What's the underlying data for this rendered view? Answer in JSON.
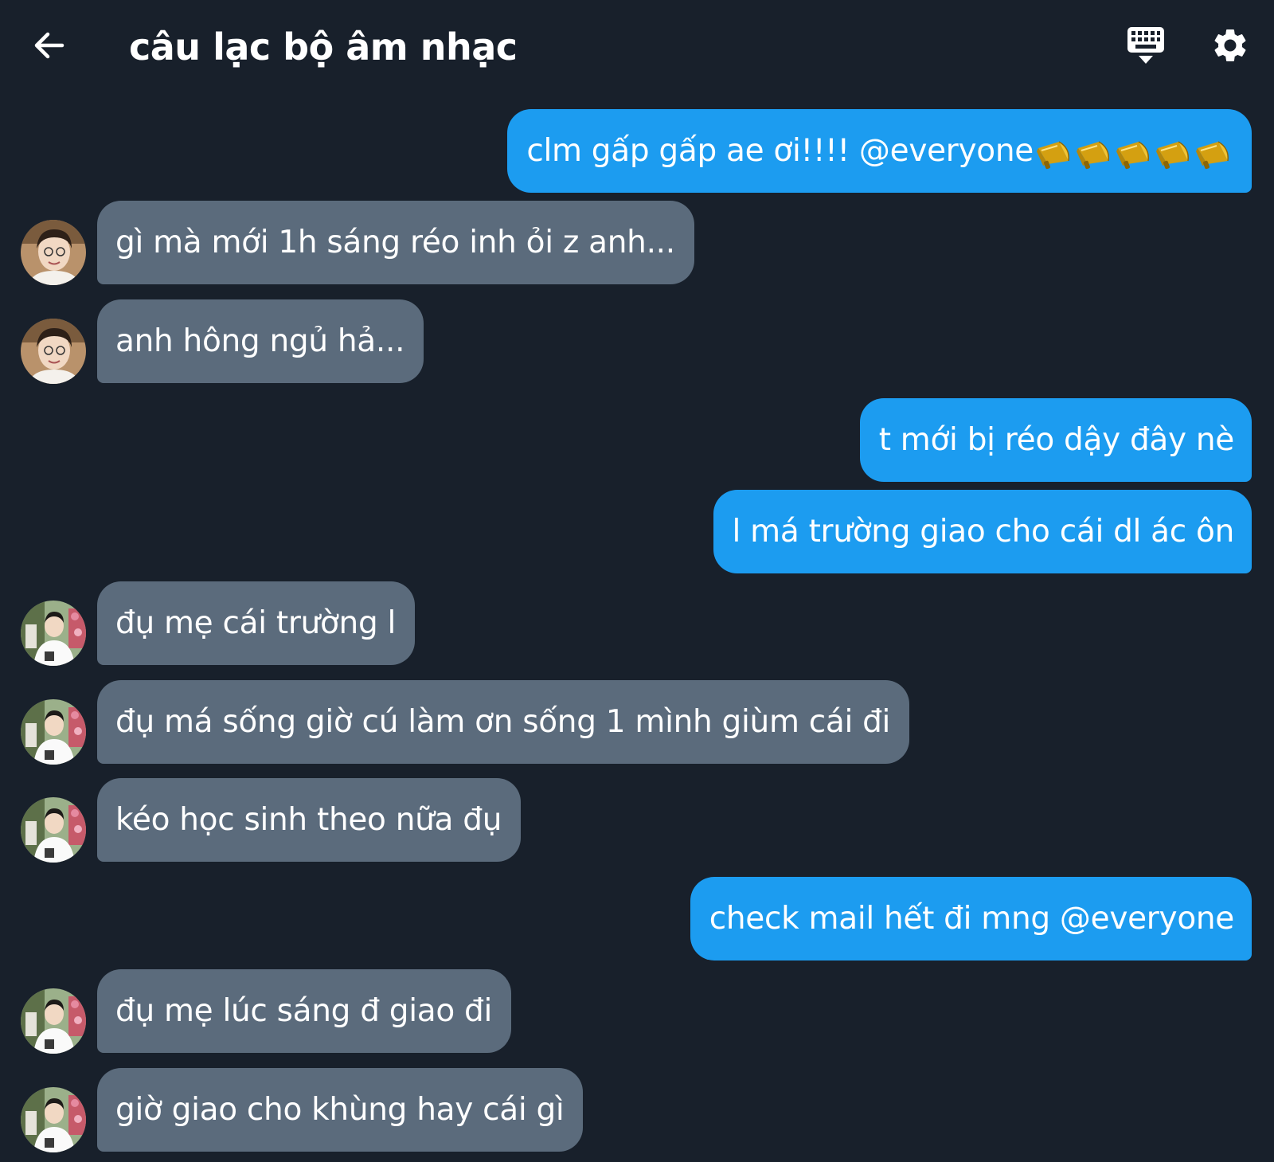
{
  "header": {
    "title": "câu lạc bộ âm nhạc",
    "back_icon": "arrow-left-icon",
    "keyboard_icon": "keyboard-icon",
    "settings_icon": "gear-icon"
  },
  "colors": {
    "background": "#18202b",
    "outgoing_bubble": "#1c9cf0",
    "incoming_bubble": "#5b6b7c",
    "text": "#ffffff"
  },
  "messages": [
    {
      "direction": "outgoing",
      "text": "clm gấp gấp ae ơi!!!! @everyone",
      "emoji": "📣📣📣📣📣"
    },
    {
      "direction": "incoming",
      "text": "gì mà mới 1h sáng réo inh ỏi z anh...",
      "avatar": "user-1"
    },
    {
      "direction": "incoming",
      "text": "anh hông ngủ hả...",
      "avatar": "user-1"
    },
    {
      "direction": "outgoing",
      "text": "t mới bị réo dậy đây nè"
    },
    {
      "direction": "outgoing",
      "text": "l má trường giao cho cái dl ác ôn"
    },
    {
      "direction": "incoming",
      "text": "đụ mẹ cái trường l",
      "avatar": "user-2"
    },
    {
      "direction": "incoming",
      "text": "đụ má sống giờ cú làm ơn sống 1 mình giùm cái đi",
      "avatar": "user-2"
    },
    {
      "direction": "incoming",
      "text": "kéo học sinh theo nữa đụ",
      "avatar": "user-2"
    },
    {
      "direction": "outgoing",
      "text": "check mail hết đi mng @everyone"
    },
    {
      "direction": "incoming",
      "text": "đụ mẹ lúc sáng đ giao đi",
      "avatar": "user-2"
    },
    {
      "direction": "incoming",
      "text": "giờ giao cho khùng hay cái gì",
      "avatar": "user-2"
    }
  ]
}
